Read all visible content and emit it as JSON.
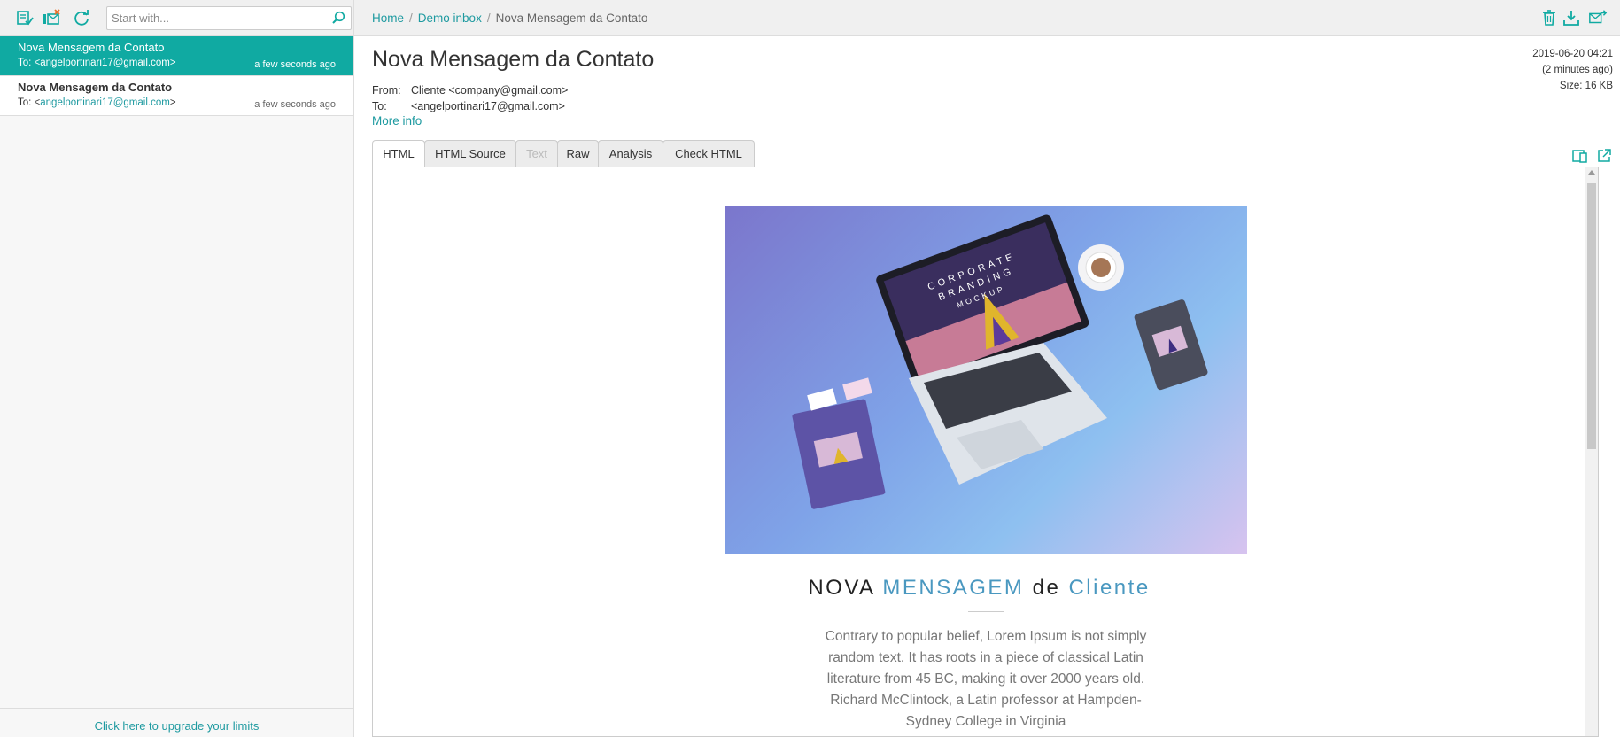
{
  "toolbar": {
    "search_placeholder": "Start with..."
  },
  "breadcrumb": {
    "home": "Home",
    "inbox": "Demo inbox",
    "current": "Nova Mensagem da Contato"
  },
  "messages": [
    {
      "subject": "Nova Mensagem da Contato",
      "to_prefix": "To: <",
      "to_email": "angelportinari17@gmail.com",
      "to_suffix": ">",
      "time": "a few seconds ago",
      "active": true
    },
    {
      "subject": "Nova Mensagem da Contato",
      "to_prefix": "To: <",
      "to_email": "angelportinari17@gmail.com",
      "to_suffix": ">",
      "time": "a few seconds ago",
      "active": false
    }
  ],
  "sidebar": {
    "upgrade_link": "Click here to upgrade your limits"
  },
  "email": {
    "subject": "Nova Mensagem da Contato",
    "date": "2019-06-20 04:21",
    "relative": "(2 minutes ago)",
    "size": "Size: 16 KB",
    "from_label": "From:",
    "from_value": "Cliente <company@gmail.com>",
    "to_label": "To:",
    "to_value": "<angelportinari17@gmail.com>",
    "more_info": "More info"
  },
  "tabs": [
    {
      "label": "HTML",
      "active": true,
      "disabled": false
    },
    {
      "label": "HTML Source",
      "active": false,
      "disabled": false
    },
    {
      "label": "Text",
      "active": false,
      "disabled": true
    },
    {
      "label": "Raw",
      "active": false,
      "disabled": false
    },
    {
      "label": "Analysis",
      "active": false,
      "disabled": false
    },
    {
      "label": "Check HTML",
      "active": false,
      "disabled": false
    }
  ],
  "content": {
    "hero_alt_lines": [
      "CORPORATE",
      "BRANDING",
      "MOCKUP"
    ],
    "heading_1": "NOVA ",
    "heading_2": "MENSAGEM",
    "heading_3": " de ",
    "heading_4": "Cliente",
    "body": "Contrary to popular belief, Lorem Ipsum is not simply random text. It has roots in a piece of classical Latin literature from 45 BC, making it over 2000 years old. Richard McClintock, a Latin professor at Hampden-Sydney College in Virginia"
  },
  "colors": {
    "accent": "#10aaa2",
    "link": "#1e9aa0",
    "heading_highlight": "#4a98c0"
  }
}
